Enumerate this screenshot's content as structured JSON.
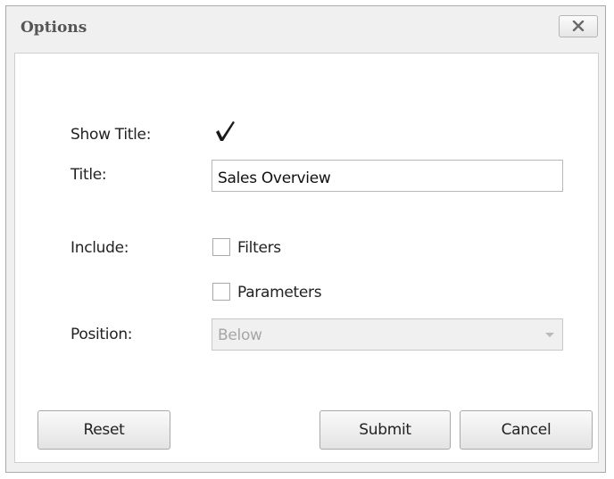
{
  "dialog": {
    "title": "Options"
  },
  "form": {
    "show_title_label": "Show Title:",
    "show_title_checked": true,
    "title_label": "Title:",
    "title_value": "Sales Overview",
    "include_label": "Include:",
    "include_options": [
      {
        "label": "Filters",
        "checked": false
      },
      {
        "label": "Parameters",
        "checked": false
      }
    ],
    "position_label": "Position:",
    "position_value": "Below"
  },
  "buttons": {
    "reset": "Reset",
    "submit": "Submit",
    "cancel": "Cancel"
  },
  "icons": {
    "close": "close-icon",
    "check": "checkmark-icon",
    "dropdown": "chevron-down-icon"
  }
}
